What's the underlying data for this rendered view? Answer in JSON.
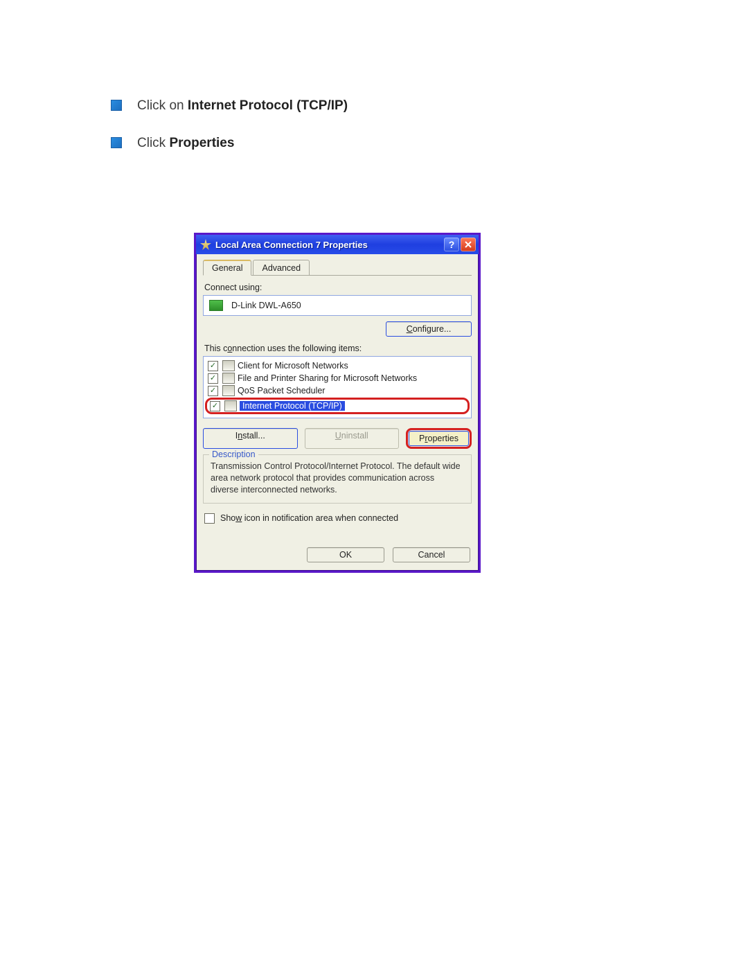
{
  "instructions": {
    "line1_prefix": "Click on ",
    "line1_bold": "Internet Protocol (TCP/IP)",
    "line2_prefix": "Click ",
    "line2_bold": "Properties"
  },
  "dialog": {
    "title": "Local Area Connection 7 Properties",
    "tabs": {
      "general": "General",
      "advanced": "Advanced"
    },
    "connect_using_label": "Connect using:",
    "adapter": "D-Link DWL-A650",
    "configure_btn": "Configure...",
    "items_label": "This connection uses the following items:",
    "items": [
      "Client for Microsoft Networks",
      "File and Printer Sharing for Microsoft Networks",
      "QoS Packet Scheduler",
      "Internet Protocol (TCP/IP)"
    ],
    "install_btn": "Install...",
    "uninstall_btn": "Uninstall",
    "properties_btn": "Properties",
    "description_label": "Description",
    "description_text": "Transmission Control Protocol/Internet Protocol. The default wide area network protocol that provides communication across diverse interconnected networks.",
    "show_icon_label": "Show icon in notification area when connected",
    "ok_btn": "OK",
    "cancel_btn": "Cancel"
  }
}
